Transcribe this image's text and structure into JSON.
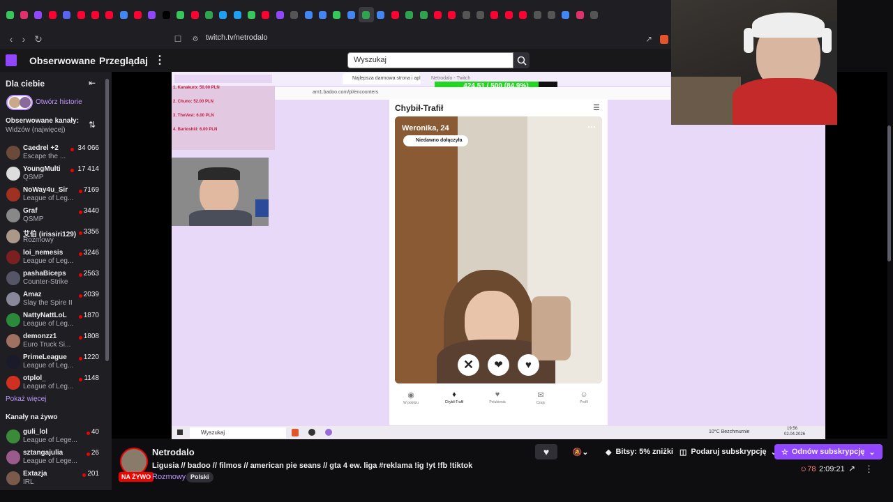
{
  "browser": {
    "url": "twitch.tv/netrodalo",
    "tab_icons": [
      "#35c759",
      "#e1306c",
      "#9146ff",
      "#ff0033",
      "#5865f2",
      "#ff0033",
      "#ff0033",
      "#ff0033",
      "#4285f4",
      "#ff0033",
      "#9146ff",
      "#000000",
      "#35c759",
      "#ff0033",
      "#2ea44f",
      "#1da1f2",
      "#1da1f2",
      "#35c759",
      "#ff0033",
      "#9146ff",
      "#555555",
      "#4285f4",
      "#4285f4",
      "#35c759",
      "#4285f4",
      "#2ea44f",
      "#4285f4",
      "#ff0033",
      "#2ea44f",
      "#2ea44f",
      "#ff0033",
      "#ff0033",
      "#555555",
      "#555555",
      "#ff0033",
      "#ff0033",
      "#ff0033",
      "#555555",
      "#555555",
      "#4285f4",
      "#e1306c",
      "#555555"
    ]
  },
  "nav": {
    "followed": "Obserwowane",
    "browse": "Przeglądaj",
    "search_placeholder": "Wyszukaj"
  },
  "sidebar": {
    "for_you": "Dla ciebie",
    "open_stories": "Otwórz historie",
    "followed_heading": "Obserwowane kanały:",
    "sort_label": "Widzów (najwięcej)",
    "channels": [
      {
        "name": "Caedrel +2",
        "game": "Escape the ...",
        "viewers": "34 066",
        "color": "#6b4a3a"
      },
      {
        "name": "YoungMulti",
        "game": "QSMP",
        "viewers": "17 414",
        "color": "#ddd"
      },
      {
        "name": "NoWay4u_Sir",
        "game": "League of Leg...",
        "viewers": "7169",
        "color": "#a03020"
      },
      {
        "name": "Graf",
        "game": "QSMP",
        "viewers": "3440",
        "color": "#888"
      },
      {
        "name": "艾伯 (irissiri129)",
        "game": "Rozmowy",
        "viewers": "3356",
        "color": "#aa9988"
      },
      {
        "name": "loi_nemesis",
        "game": "League of Leg...",
        "viewers": "3246",
        "color": "#7a2020"
      },
      {
        "name": "pashaBiceps",
        "game": "Counter-Strike",
        "viewers": "2563",
        "color": "#556"
      },
      {
        "name": "Amaz",
        "game": "Slay the Spire II",
        "viewers": "2039",
        "color": "#889"
      },
      {
        "name": "NattyNattLoL",
        "game": "League of Leg...",
        "viewers": "1870",
        "color": "#2a8a3a"
      },
      {
        "name": "demonzz1",
        "game": "Euro Truck Si...",
        "viewers": "1808",
        "color": "#a07060"
      },
      {
        "name": "PrimeLeague",
        "game": "League of Leg...",
        "viewers": "1220",
        "color": "#1a1a2a"
      },
      {
        "name": "otplol_",
        "game": "League of Leg...",
        "viewers": "1148",
        "color": "#d03020"
      }
    ],
    "show_more": "Pokaż więcej",
    "live_heading": "Kanały na żywo",
    "live_channels": [
      {
        "name": "guli_lol",
        "game": "League of Lege...",
        "viewers": "40",
        "color": "#3a8a3a"
      },
      {
        "name": "sztangajulia",
        "game": "League of Lege...",
        "viewers": "26",
        "color": "#9a5a8a"
      },
      {
        "name": "Extazja",
        "game": "IRL",
        "viewers": "201",
        "color": "#7a5a4a"
      }
    ]
  },
  "stream_content": {
    "overlay_tab1": "Najlepsza darmowa strona i apli...",
    "overlay_tab2": "Netrodalo - Twitch",
    "overlay_url": "am1.badoo.com/pl/encounters",
    "goal": "424.51 / 500 (84.9%)",
    "goal_fraction": 0.849,
    "donors": [
      "1. Kanakuro: 50.00 PLN",
      "2. Chuno: 52.00 PLN",
      "3. TheVest: 6.00 PLN",
      "4. Bartoshiii: 6.00 PLN"
    ],
    "app_title": "Chybił-Trafił",
    "profile_name": "Weronika, 24",
    "profile_badge": "Niedawno dołączyła",
    "bottom_nav": [
      "W pobliżu",
      "Chybił-Trafił",
      "Polubienia",
      "Czaty",
      "Profil"
    ],
    "taskbar_search": "Wyszukaj",
    "weather": "10°C  Bezchmurnie",
    "clock_time": "19:56",
    "clock_date": "02.04.2026"
  },
  "channel": {
    "name": "Netrodalo",
    "title": "Ligusia // badoo // filmos // american pie seans // gta 4 ew. liga #reklama !ig !yt !fb !tiktok",
    "live_badge": "NA ŻYWO",
    "category": "Rozmowy",
    "tag": "Polski",
    "bits_label": "Bitsy: 5% zniżki",
    "gift_label": "Podaruj subskrypcję",
    "resub_label": "Odnów subskrypcję",
    "viewers": "78",
    "uptime": "2:09:21"
  },
  "colors": {
    "twitch_purple": "#9146ff",
    "live_red": "#eb0400",
    "link_purple": "#bf94ff",
    "goal_green": "#22d622",
    "stream_bg": "#e7d9f7"
  }
}
